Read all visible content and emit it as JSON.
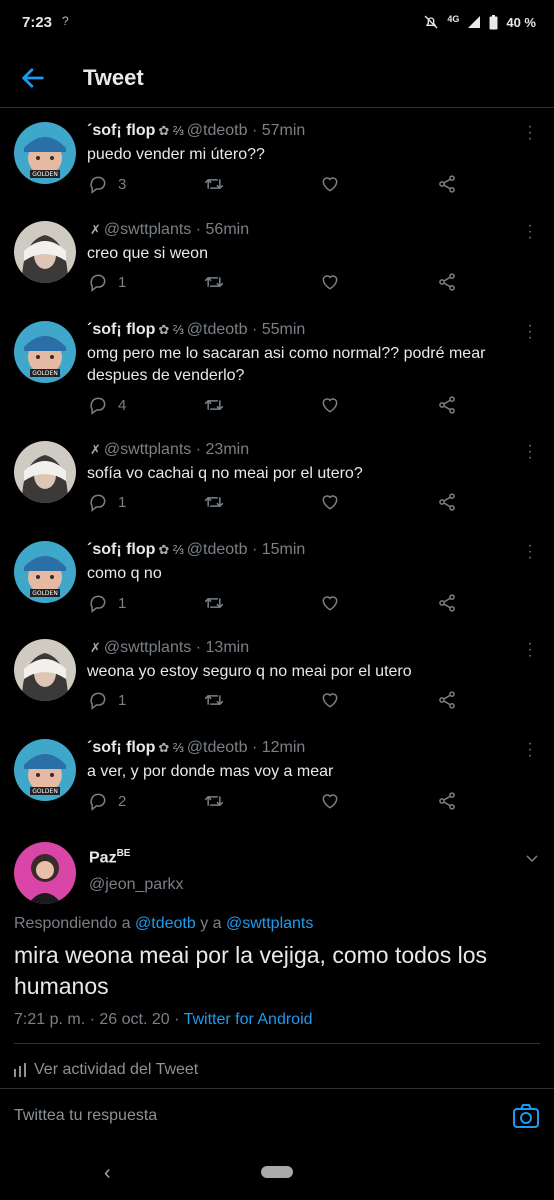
{
  "status_bar": {
    "time": "7:23",
    "left_signal": "?",
    "network": "4G",
    "battery": "40 %"
  },
  "header": {
    "title": "Tweet"
  },
  "replies": [
    {
      "author": "sof¡ flop",
      "prefix": "´",
      "badges": "✿ ⅔",
      "handle": "@tdeotb",
      "time": "57min",
      "text": "puedo vender mi útero??",
      "reply_count": "3"
    },
    {
      "author": "",
      "prefix": "",
      "badges": "✗",
      "handle": "@swttplants",
      "time": "56min",
      "text": "creo que si weon",
      "reply_count": "1"
    },
    {
      "author": "sof¡ flop",
      "prefix": "´",
      "badges": "✿ ⅔",
      "handle": "@tdeotb",
      "time": "55min",
      "text": "omg pero me lo sacaran asi como normal?? podré mear despues de venderlo?",
      "reply_count": "4"
    },
    {
      "author": "",
      "prefix": "",
      "badges": "✗",
      "handle": "@swttplants",
      "time": "23min",
      "text": "sofía vo cachai q no meai por el utero?",
      "reply_count": "1"
    },
    {
      "author": "sof¡ flop",
      "prefix": "´",
      "badges": "✿ ⅔",
      "handle": "@tdeotb",
      "time": "15min",
      "text": "como q no",
      "reply_count": "1"
    },
    {
      "author": "",
      "prefix": "",
      "badges": "✗",
      "handle": "@swttplants",
      "time": "13min",
      "text": "weona yo estoy seguro q no meai por el utero",
      "reply_count": "1"
    },
    {
      "author": "sof¡ flop",
      "prefix": "´",
      "badges": "✿ ⅔",
      "handle": "@tdeotb",
      "time": "12min",
      "text": "a ver, y por donde mas voy a mear",
      "reply_count": "2"
    }
  ],
  "main_tweet": {
    "author": "Paz",
    "author_sup": "BE",
    "handle": "@jeon_parkx",
    "replying_prefix": "Respondiendo a",
    "replying_to_1": "@tdeotb",
    "replying_join": "y a",
    "replying_to_2": "@swttplants",
    "text": "mira weona meai por la vejiga, como todos los humanos",
    "timestamp": "7:21 p. m. · 26 oct. 20 ·",
    "source": "Twitter for Android"
  },
  "activity_label": "Ver actividad del Tweet",
  "composer": {
    "placeholder": "Twittea tu respuesta"
  },
  "colors": {
    "accent": "#1d9bf0",
    "background": "#000000",
    "muted": "#7a8086"
  }
}
